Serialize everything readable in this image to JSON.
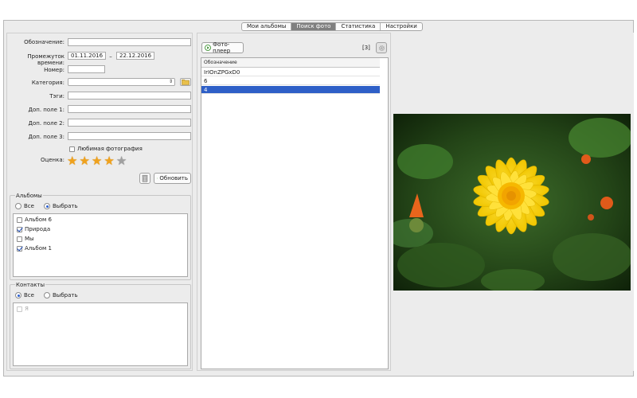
{
  "tabs": [
    {
      "label": "Мои альбомы",
      "active": false
    },
    {
      "label": "Поиск фото",
      "active": true
    },
    {
      "label": "Статистика",
      "active": false
    },
    {
      "label": "Настройки",
      "active": false
    }
  ],
  "form": {
    "designation_label": "Обозначение:",
    "designation_value": "",
    "time_range_label": "Промежуток времени:",
    "date_from": "01.11.2016",
    "date_sep": "–",
    "date_to": "22.12.2016",
    "number_label": "Номер:",
    "number_value": "",
    "category_label": "Категория:",
    "category_value": "",
    "tags_label": "Тэги:",
    "tags_value": "",
    "extra1_label": "Доп. поле 1:",
    "extra2_label": "Доп. поле 2:",
    "extra3_label": "Доп. поле 3:",
    "favorite_label": "Любимая фотография",
    "favorite_checked": false,
    "rating_label": "Оценка:",
    "rating": 4,
    "rating_max": 5,
    "refresh_label": "Обновить"
  },
  "albums": {
    "title": "Альбомы",
    "radio_all": "Все",
    "radio_choose": "Выбрать",
    "selected": "choose",
    "items": [
      {
        "label": "Альбом 6",
        "checked": false
      },
      {
        "label": "Природа",
        "checked": true
      },
      {
        "label": "Мы",
        "checked": false
      },
      {
        "label": "Альбом 1",
        "checked": true
      }
    ]
  },
  "contacts": {
    "title": "Контакты",
    "radio_all": "Все",
    "radio_choose": "Выбрать",
    "selected": "all",
    "items": [
      {
        "label": "Я",
        "checked": false
      }
    ]
  },
  "results": {
    "player_label": "Фото-плеер",
    "count": "[3]",
    "column_header": "Обозначение",
    "rows": [
      {
        "label": "IrIOnZPGxD0",
        "selected": false
      },
      {
        "label": "6",
        "selected": false
      },
      {
        "label": "4",
        "selected": true
      }
    ]
  },
  "colors": {
    "selection": "#2e5fc7",
    "star_gold": "#f0a21c",
    "star_gray": "#a0a0a0",
    "refresh_green": "#3a9a2a"
  }
}
